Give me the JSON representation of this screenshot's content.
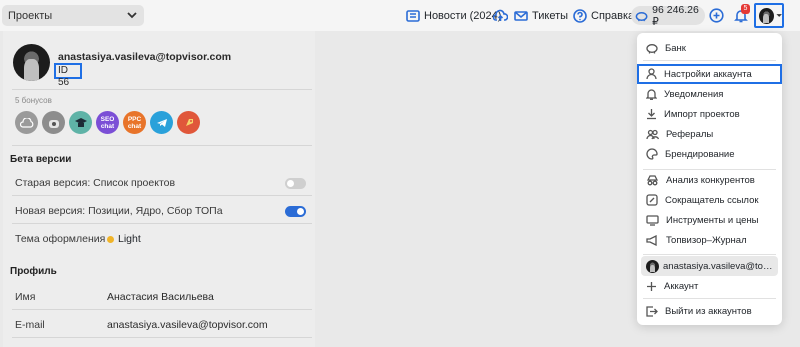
{
  "topbar": {
    "project_select": "Проекты",
    "news": "Новости (2024)",
    "tickets": "Тикеты",
    "help": "Справка",
    "balance": "96 246.26 ₽",
    "notifications_count": "5"
  },
  "profile": {
    "email": "anastasiya.vasileva@topvisor.com",
    "id_label": "ID 56",
    "bonus_label": "5 бонусов",
    "bonus_badges": [
      "SEO chat",
      "PPC chat"
    ]
  },
  "beta": {
    "title": "Бета версии",
    "old_version": "Старая версия: Список проектов",
    "new_version": "Новая версия: Позиции, Ядро, Сбор ТОПа",
    "theme_label": "Тема оформления",
    "theme_value": "Light"
  },
  "profile_section": {
    "title": "Профиль",
    "name_label": "Имя",
    "name_value": "Анастасия Васильева",
    "email_label": "E-mail",
    "email_value": "anastasiya.vasileva@topvisor.com"
  },
  "menu": {
    "items": [
      "Банк",
      "Настройки аккаунта",
      "Уведомления",
      "Импорт проектов",
      "Рефералы",
      "Брендирование",
      "Анализ конкурентов",
      "Сокращатель ссылок",
      "Инструменты и цены",
      "Топвизор–Журнал"
    ],
    "current_user": "anastasiya.vasileva@topvisor.com",
    "add_account": "Аккаунт",
    "logout": "Выйти из аккаунтов"
  },
  "colors": {
    "accent": "#1f6fe5",
    "toggle_on": "#2b6cd6",
    "toggle_off": "#cfcfcf",
    "badge": "#e53935"
  }
}
